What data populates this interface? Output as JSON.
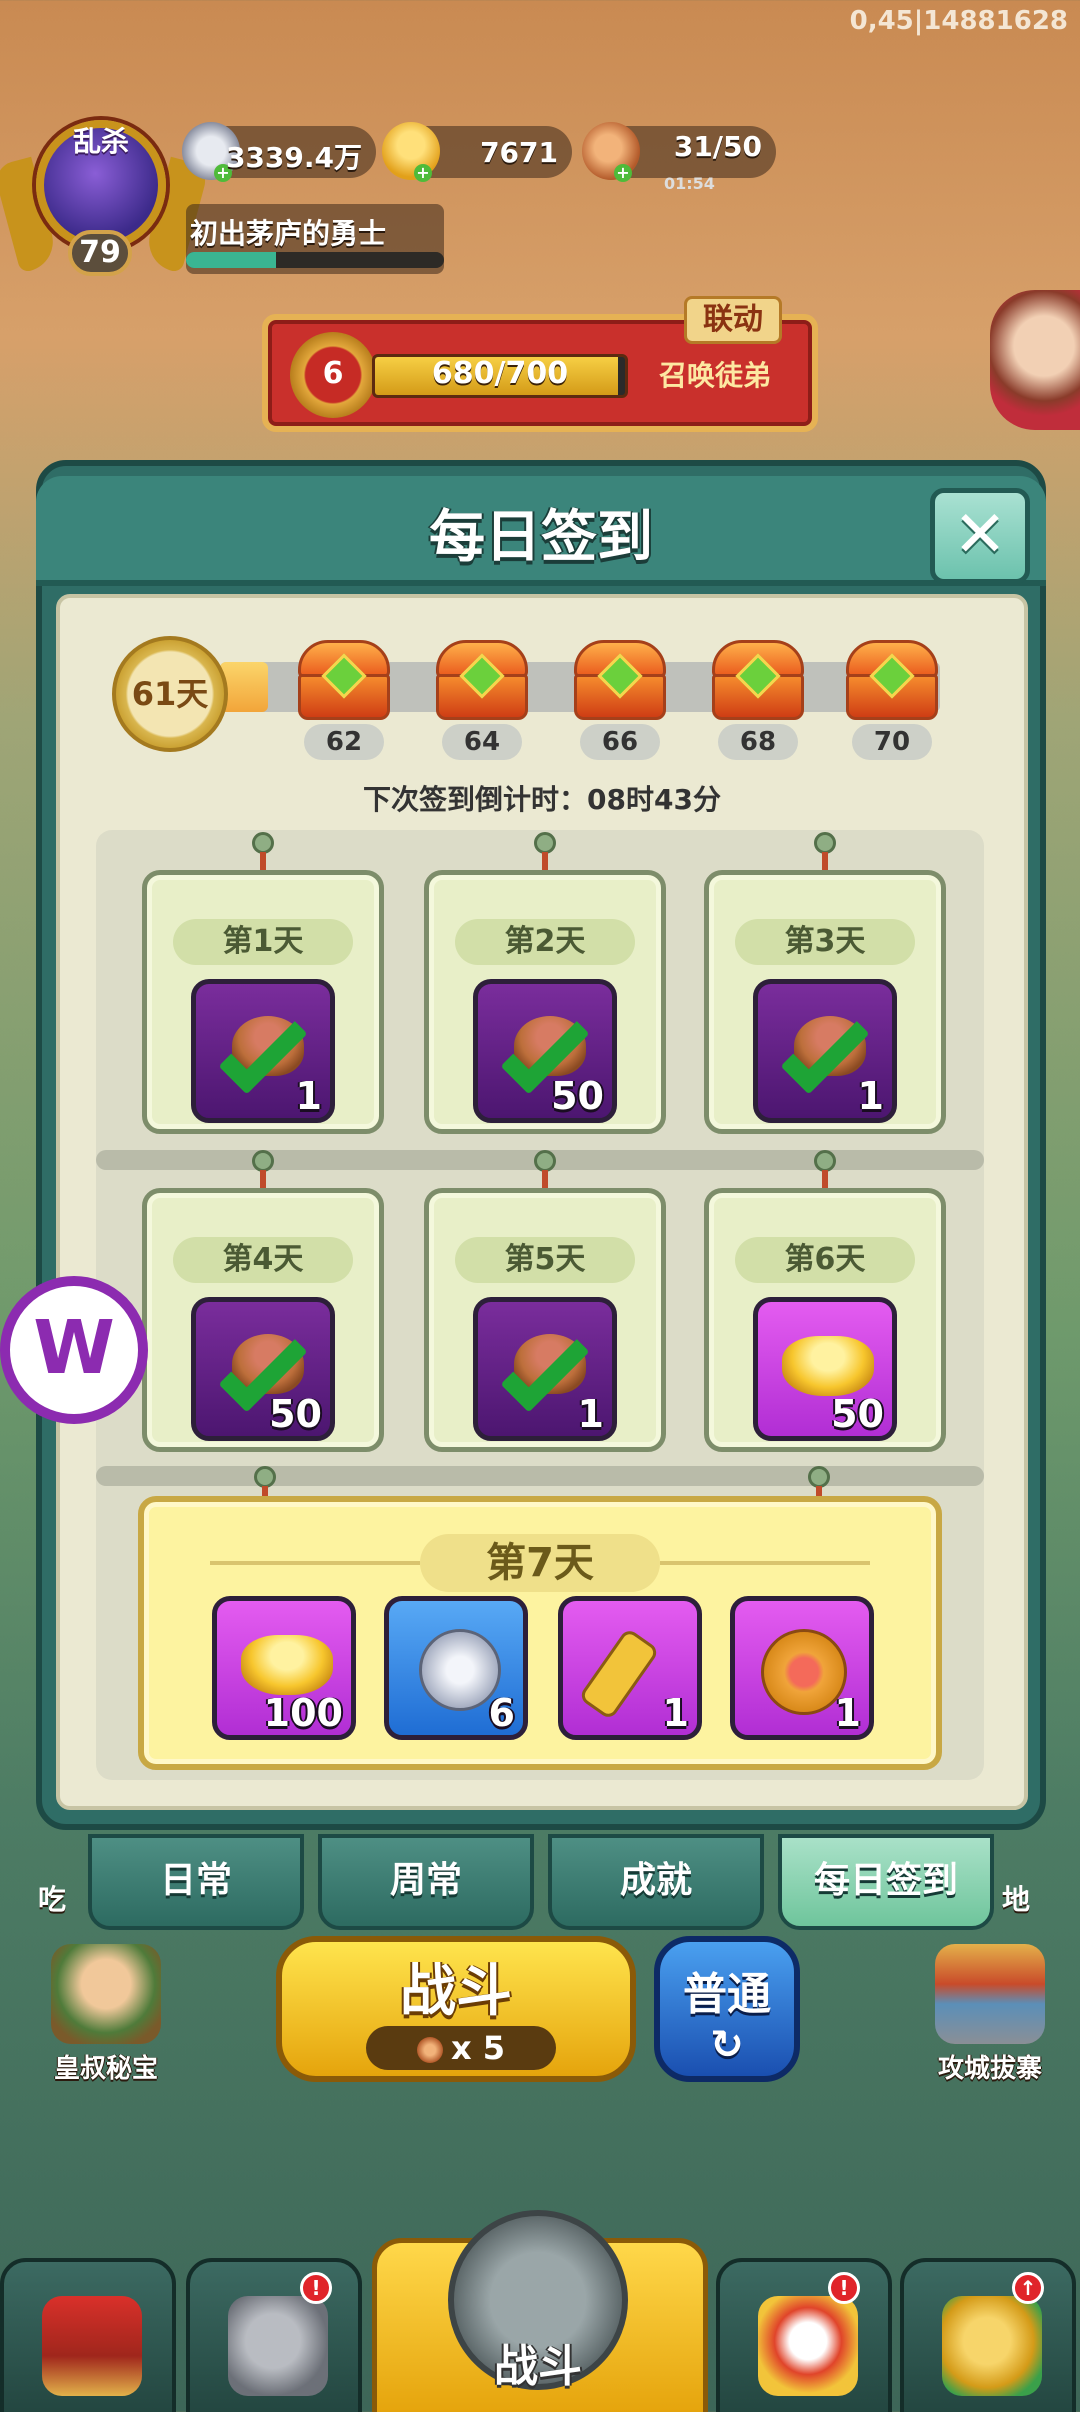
{
  "status": {
    "coord_text": "0,45|14881628"
  },
  "player": {
    "avatar_title": "乱杀",
    "level": "79",
    "name": "初出茅庐的勇士",
    "exp_fraction": 0.35
  },
  "resources": {
    "silver": "3339.4万",
    "gold": "7671",
    "stamina": "31/50",
    "stamina_timer": "01:54",
    "plus": "+"
  },
  "event": {
    "badge": "6",
    "progress_text": "680/700",
    "progress_fraction": 0.971,
    "button": "召唤徒弟",
    "tag": "联动"
  },
  "modal": {
    "title": "每日签到",
    "close": "✕",
    "streak_days": "61天",
    "streak_fill_fraction": 0.06,
    "milestones": [
      "62",
      "64",
      "66",
      "68",
      "70"
    ],
    "countdown": "下次签到倒计时：08时43分",
    "days": [
      {
        "label": "第1天",
        "qty": "1",
        "claimed": true,
        "style": "purple-dark"
      },
      {
        "label": "第2天",
        "qty": "50",
        "claimed": true,
        "style": "purple-dark"
      },
      {
        "label": "第3天",
        "qty": "1",
        "claimed": true,
        "style": "purple-dark"
      },
      {
        "label": "第4天",
        "qty": "50",
        "claimed": true,
        "style": "purple-dark"
      },
      {
        "label": "第5天",
        "qty": "1",
        "claimed": true,
        "style": "purple-dark"
      },
      {
        "label": "第6天",
        "qty": "50",
        "claimed": false,
        "style": "purple-bright"
      }
    ],
    "day7": {
      "label": "第7天",
      "items": [
        {
          "icon": "gold-ingot-icon",
          "qty": "100",
          "style": "purple-bright"
        },
        {
          "icon": "silver-coin-icon",
          "qty": "6",
          "style": "blue"
        },
        {
          "icon": "key-icon",
          "qty": "1",
          "style": "purple-bright"
        },
        {
          "icon": "medal-icon",
          "qty": "1",
          "style": "purple-bright"
        }
      ]
    }
  },
  "tabs": [
    "日常",
    "周常",
    "成就",
    "每日签到"
  ],
  "active_tab": 3,
  "battle": {
    "label": "战斗",
    "cost": "x 5",
    "mode": "普通",
    "mode_icon": "↻"
  },
  "side_left": {
    "label": "皇叔秘宝",
    "frag": "吃"
  },
  "side_right": {
    "label": "攻城拔寨",
    "frag": "地"
  },
  "nav": {
    "center_label": "战斗",
    "alert": "!",
    "upgrade": "↑"
  },
  "floating": {
    "label": "W"
  },
  "colors": {
    "accent": "#3b857b",
    "claimed_check": "#1ea436",
    "alert": "#e0242a"
  }
}
